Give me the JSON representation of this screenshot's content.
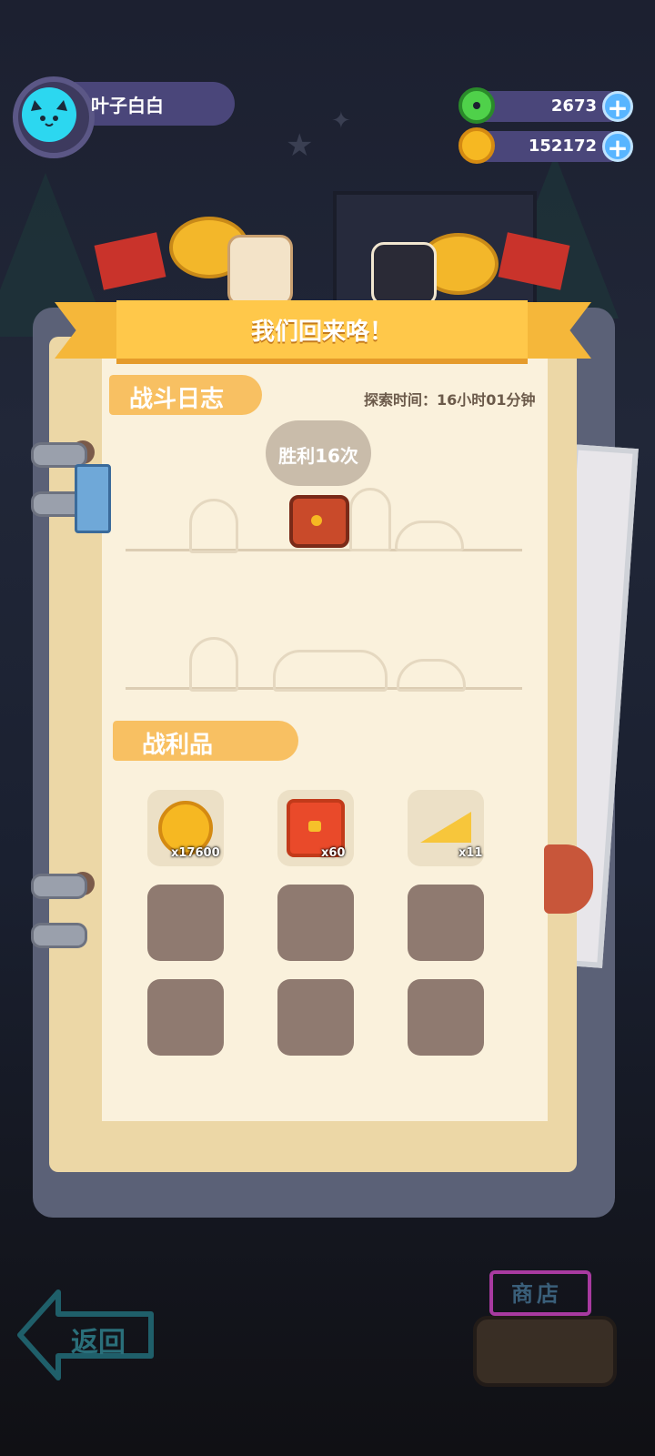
{
  "player": {
    "name": "叶子白白",
    "avatar_icon": "cat-avatar-icon"
  },
  "currencies": [
    {
      "name": "green-donut",
      "value": "2673",
      "color": "#4fd14a"
    },
    {
      "name": "gold-coin",
      "value": "152172",
      "color": "#f6b822"
    }
  ],
  "banner": {
    "title": "我们回来咯！"
  },
  "battle_log": {
    "label": "战斗日志",
    "explore_time": "探索时间：16小时01分钟",
    "bubble": "胜利16次"
  },
  "loot": {
    "label": "战利品",
    "items": [
      {
        "icon": "gold-coin-icon",
        "qty": "x17600"
      },
      {
        "icon": "red-envelope-icon",
        "qty": "x60"
      },
      {
        "icon": "cheese-icon",
        "qty": "x11"
      }
    ]
  },
  "nav": {
    "back_label": "返回",
    "shop_label": "商店"
  },
  "colors": {
    "banner": "#ffc84a",
    "label_tag": "#f8c062",
    "empty_slot": "#8f7a70"
  }
}
